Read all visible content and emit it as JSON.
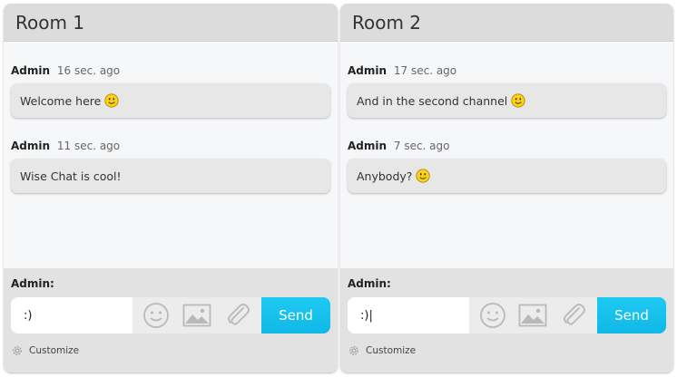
{
  "rooms": [
    {
      "title": "Room 1",
      "messages": [
        {
          "author": "Admin",
          "time": "16 sec. ago",
          "text": "Welcome here",
          "smiley": true
        },
        {
          "author": "Admin",
          "time": "11 sec. ago",
          "text": "Wise Chat is cool!",
          "smiley": false
        }
      ],
      "input": {
        "label": "Admin:",
        "value": ":)"
      },
      "send_label": "Send",
      "customize_label": "Customize"
    },
    {
      "title": "Room 2",
      "messages": [
        {
          "author": "Admin",
          "time": "17 sec. ago",
          "text": "And in the second channel ",
          "smiley": true
        },
        {
          "author": "Admin",
          "time": "7 sec. ago",
          "text": "Anybody? ",
          "smiley": true
        }
      ],
      "input": {
        "label": "Admin:",
        "value": ":)|"
      },
      "send_label": "Send",
      "customize_label": "Customize"
    }
  ],
  "icons": {
    "emoticon": "smiley-face-icon",
    "image": "image-icon",
    "attach": "paperclip-icon",
    "settings": "gear-icon"
  },
  "colors": {
    "send_button": "#14c0ea",
    "header_bg": "#dcdcdc",
    "bubble_bg": "#e7e7e7",
    "input_area_bg": "#e2e2e2"
  }
}
